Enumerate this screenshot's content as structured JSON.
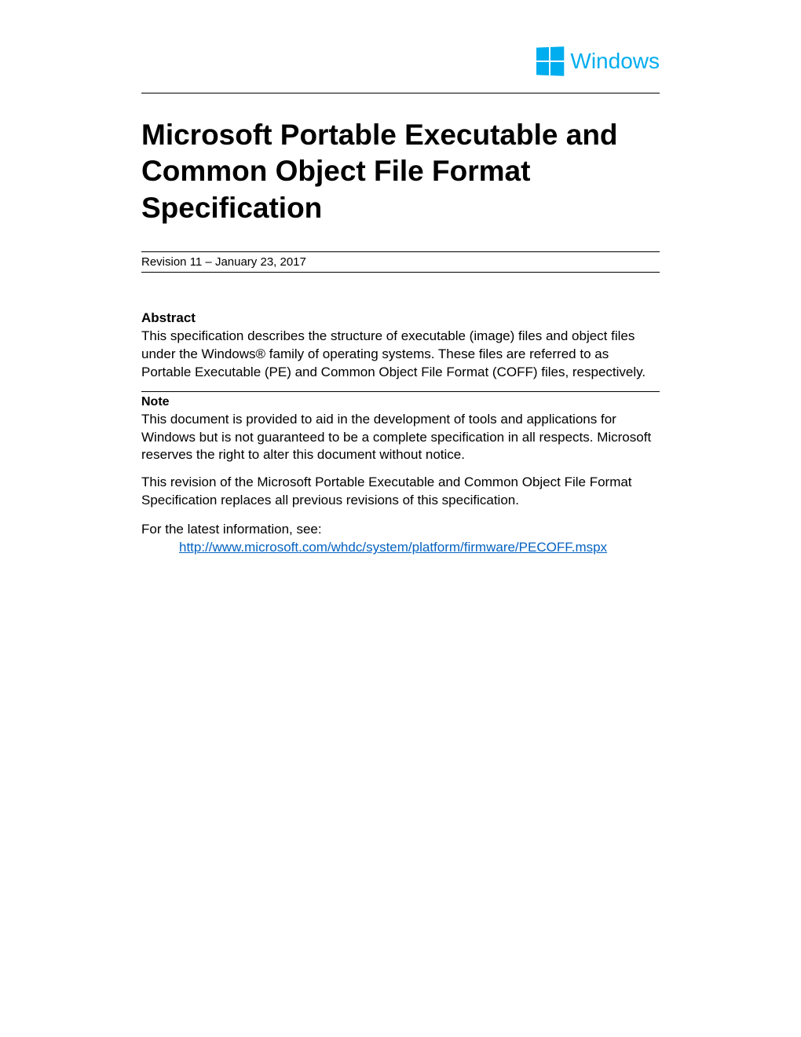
{
  "logo": {
    "text": "Windows",
    "color": "#00adef"
  },
  "title": "Microsoft Portable Executable and Common Object File Format Specification",
  "revision": "Revision 11 – January 23, 2017",
  "abstract": {
    "heading": "Abstract",
    "text": "This specification describes the structure of executable (image) files and object files under the Windows® family of operating systems. These files are referred to as Portable Executable (PE) and Common Object File Format (COFF) files, respectively."
  },
  "note": {
    "heading": "Note",
    "text": "This document is provided to aid in the development of tools and applications for Windows but is not guaranteed to be a complete specification in all respects. Microsoft reserves the right to alter this document without notice."
  },
  "revision_note": "This revision of the Microsoft Portable Executable and Common Object File Format Specification replaces all previous revisions of this specification.",
  "latest": {
    "intro": "For the latest information, see:",
    "url": "http://www.microsoft.com/whdc/system/platform/firmware/PECOFF.mspx"
  }
}
